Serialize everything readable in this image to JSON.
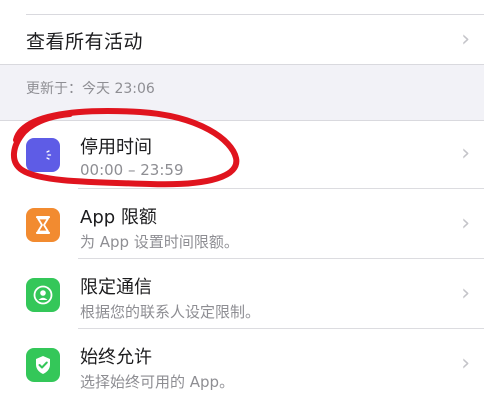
{
  "view_all": {
    "label": "查看所有活动"
  },
  "updated": {
    "label": "更新于：今天 23:06"
  },
  "rows": [
    {
      "title": "停用时间",
      "subtitle": "00:00 – 23:59",
      "icon": "downtime-icon",
      "color": "#5e5ce6"
    },
    {
      "title": "App 限额",
      "subtitle": "为 App 设置时间限额。",
      "icon": "hourglass-icon",
      "color": "#f28b30"
    },
    {
      "title": "限定通信",
      "subtitle": "根据您的联系人设定限制。",
      "icon": "person-icon",
      "color": "#34c759"
    },
    {
      "title": "始终允许",
      "subtitle": "选择始终可用的 App。",
      "icon": "checkmark-shield-icon",
      "color": "#34c759"
    }
  ],
  "chevron": "›",
  "annotation_color": "#e0141e"
}
